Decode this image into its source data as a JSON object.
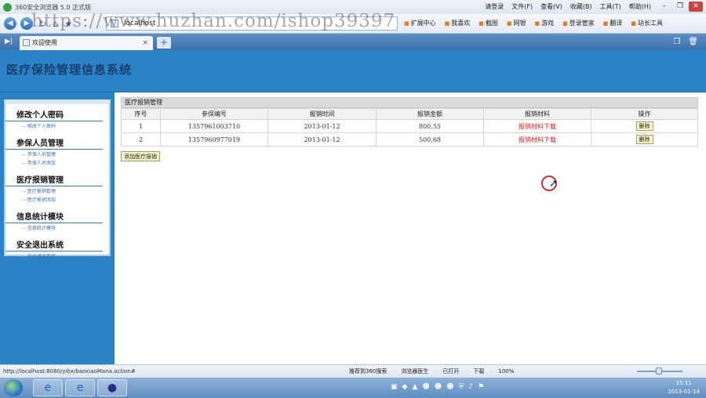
{
  "browser": {
    "title": "360安全浏览器 5.0 正式版",
    "menus": [
      "请登录",
      "文件(F)",
      "查看(V)",
      "收藏(B)",
      "工具(T)",
      "帮助(H)"
    ],
    "address": "localhost",
    "watermark": "https://www.huzhan.com/ishop39397",
    "toolbar_items": [
      "扩展中心",
      "我喜欢",
      "截图",
      "网银",
      "游戏",
      "登录管家",
      "翻译",
      "站长工具"
    ],
    "tab_label": "欢迎使用"
  },
  "system": {
    "title": "医疗保险管理信息系统"
  },
  "sidebar": {
    "groups": [
      {
        "heading": "修改个人密码",
        "links": [
          "修改个人密码"
        ]
      },
      {
        "heading": "参保人员管理",
        "links": [
          "参保人员管理",
          "参保人员添加"
        ]
      },
      {
        "heading": "医疗报销管理",
        "links": [
          "医疗报销管理",
          "医疗报销添加"
        ]
      },
      {
        "heading": "信息统计模块",
        "links": [
          "信息统计模块"
        ]
      },
      {
        "heading": "安全退出系统",
        "links": [
          "安全退出系统"
        ]
      }
    ]
  },
  "main": {
    "section_title": "医疗报销管理",
    "columns": [
      "序号",
      "参保编号",
      "报销时间",
      "报销金额",
      "报销材料",
      "操作"
    ],
    "rows": [
      {
        "no": "1",
        "id": "1357961003710",
        "date": "2013-01-12",
        "amount": "800.55",
        "material": "报销材料下载",
        "action": "删除"
      },
      {
        "no": "2",
        "id": "1357960977019",
        "date": "2013-01-12",
        "amount": "500.68",
        "material": "报销材料下载",
        "action": "删除"
      }
    ],
    "add_button": "添加医疗报销"
  },
  "status": {
    "url": "http://localhost:8080/yibx/baoxiaoMana.action#",
    "items": [
      "推荐到360搜索",
      "浏览器医生",
      "已打开",
      "下载",
      "100%"
    ]
  },
  "clock": {
    "time": "15:11",
    "date": "2013-01-14"
  }
}
